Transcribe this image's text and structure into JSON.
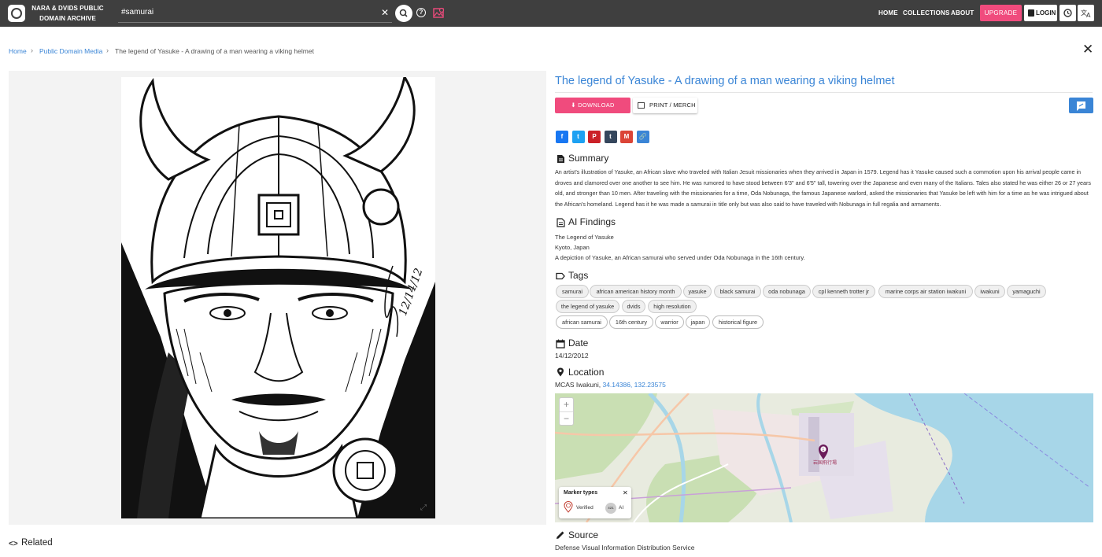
{
  "header": {
    "brand_line1": "NARA & DVIDS PUBLIC",
    "brand_line2": "DOMAIN ARCHIVE",
    "search_value": "#samurai",
    "nav": [
      "HOME",
      "COLLECTIONS",
      "ABOUT"
    ],
    "upgrade_label": "UPGRADE",
    "login_label": "LOGIN",
    "icons": [
      "archive-logo-icon",
      "clear-icon",
      "search-icon",
      "help-icon",
      "image-search-icon",
      "history-icon",
      "translate-icon"
    ],
    "accent_color": "#f04b7d"
  },
  "breadcrumb": {
    "home": "Home",
    "section": "Public Domain Media",
    "current": "The legend of Yasuke - A drawing of a man wearing a viking helmet"
  },
  "image": {
    "signature_text": "12/14/12"
  },
  "related": {
    "label": "Related"
  },
  "detail": {
    "title": "The legend of Yasuke - A drawing of a man wearing a viking helmet",
    "download_label": "DOWNLOAD",
    "print_label": "PRINT / MERCH",
    "share": [
      {
        "name": "facebook",
        "glyph": "f",
        "color": "#1877f2"
      },
      {
        "name": "twitter",
        "glyph": "t",
        "color": "#1da1f2"
      },
      {
        "name": "pinterest",
        "glyph": "P",
        "color": "#cb2027"
      },
      {
        "name": "tumblr",
        "glyph": "t",
        "color": "#35465c"
      },
      {
        "name": "gmail",
        "glyph": "M",
        "color": "#db4437"
      },
      {
        "name": "copy-link",
        "glyph": "🔗",
        "color": "#3a85d6"
      }
    ],
    "summary_title": "Summary",
    "summary": "An artist's illustration of Yasuke, an African slave who traveled with Italian Jesuit missionaries when they arrived in Japan in 1579. Legend has it Yasuke caused such a commotion upon his arrival people came in droves and clamored over one another to see him. He was rumored to have stood between 6'3\" and 6'5\" tall, towering over the Japanese and even many of the Italians. Tales also stated he was either 26 or 27 years old, and stronger than 10 men. After traveling with the missionaries for a time, Oda Nobunaga, the famous Japanese warlord, asked the missionaries that Yasuke be left with him for a time as he was intrigued about the African's homeland. Legend has it he was made a samurai in title only but was also said to have traveled with Nobunaga in full regalia and armaments.",
    "ai_title": "AI Findings",
    "ai_findings": [
      "The Legend of Yasuke",
      "Kyoto, Japan",
      "A depiction of Yasuke, an African samurai who served under Oda Nobunaga in the 16th century."
    ],
    "tags_title": "Tags",
    "tags": [
      "samurai",
      "african american history month",
      "yasuke",
      "black samurai",
      "oda nobunaga",
      "cpl kenneth trotter jr",
      "marine corps air station iwakuni",
      "iwakuni",
      "yamaguchi",
      "the legend of yasuke",
      "dvids",
      "high resolution",
      "african samurai",
      "16th century",
      "warrior",
      "japan",
      "historical figure"
    ],
    "date_title": "Date",
    "date": "14/12/2012",
    "location_title": "Location",
    "location_name": "MCAS Iwakuni, ",
    "location_coords": "34.14386, 132.23575",
    "map": {
      "zoom_in": "+",
      "zoom_out": "−",
      "legend_title": "Marker types",
      "legend_close": "✕",
      "verified_label": "Verified",
      "ai_count": "421",
      "ai_label": "AI",
      "place_label": "岩国飛行場"
    },
    "source_title": "Source",
    "source": "Defense Visual Information Distribution Service"
  }
}
